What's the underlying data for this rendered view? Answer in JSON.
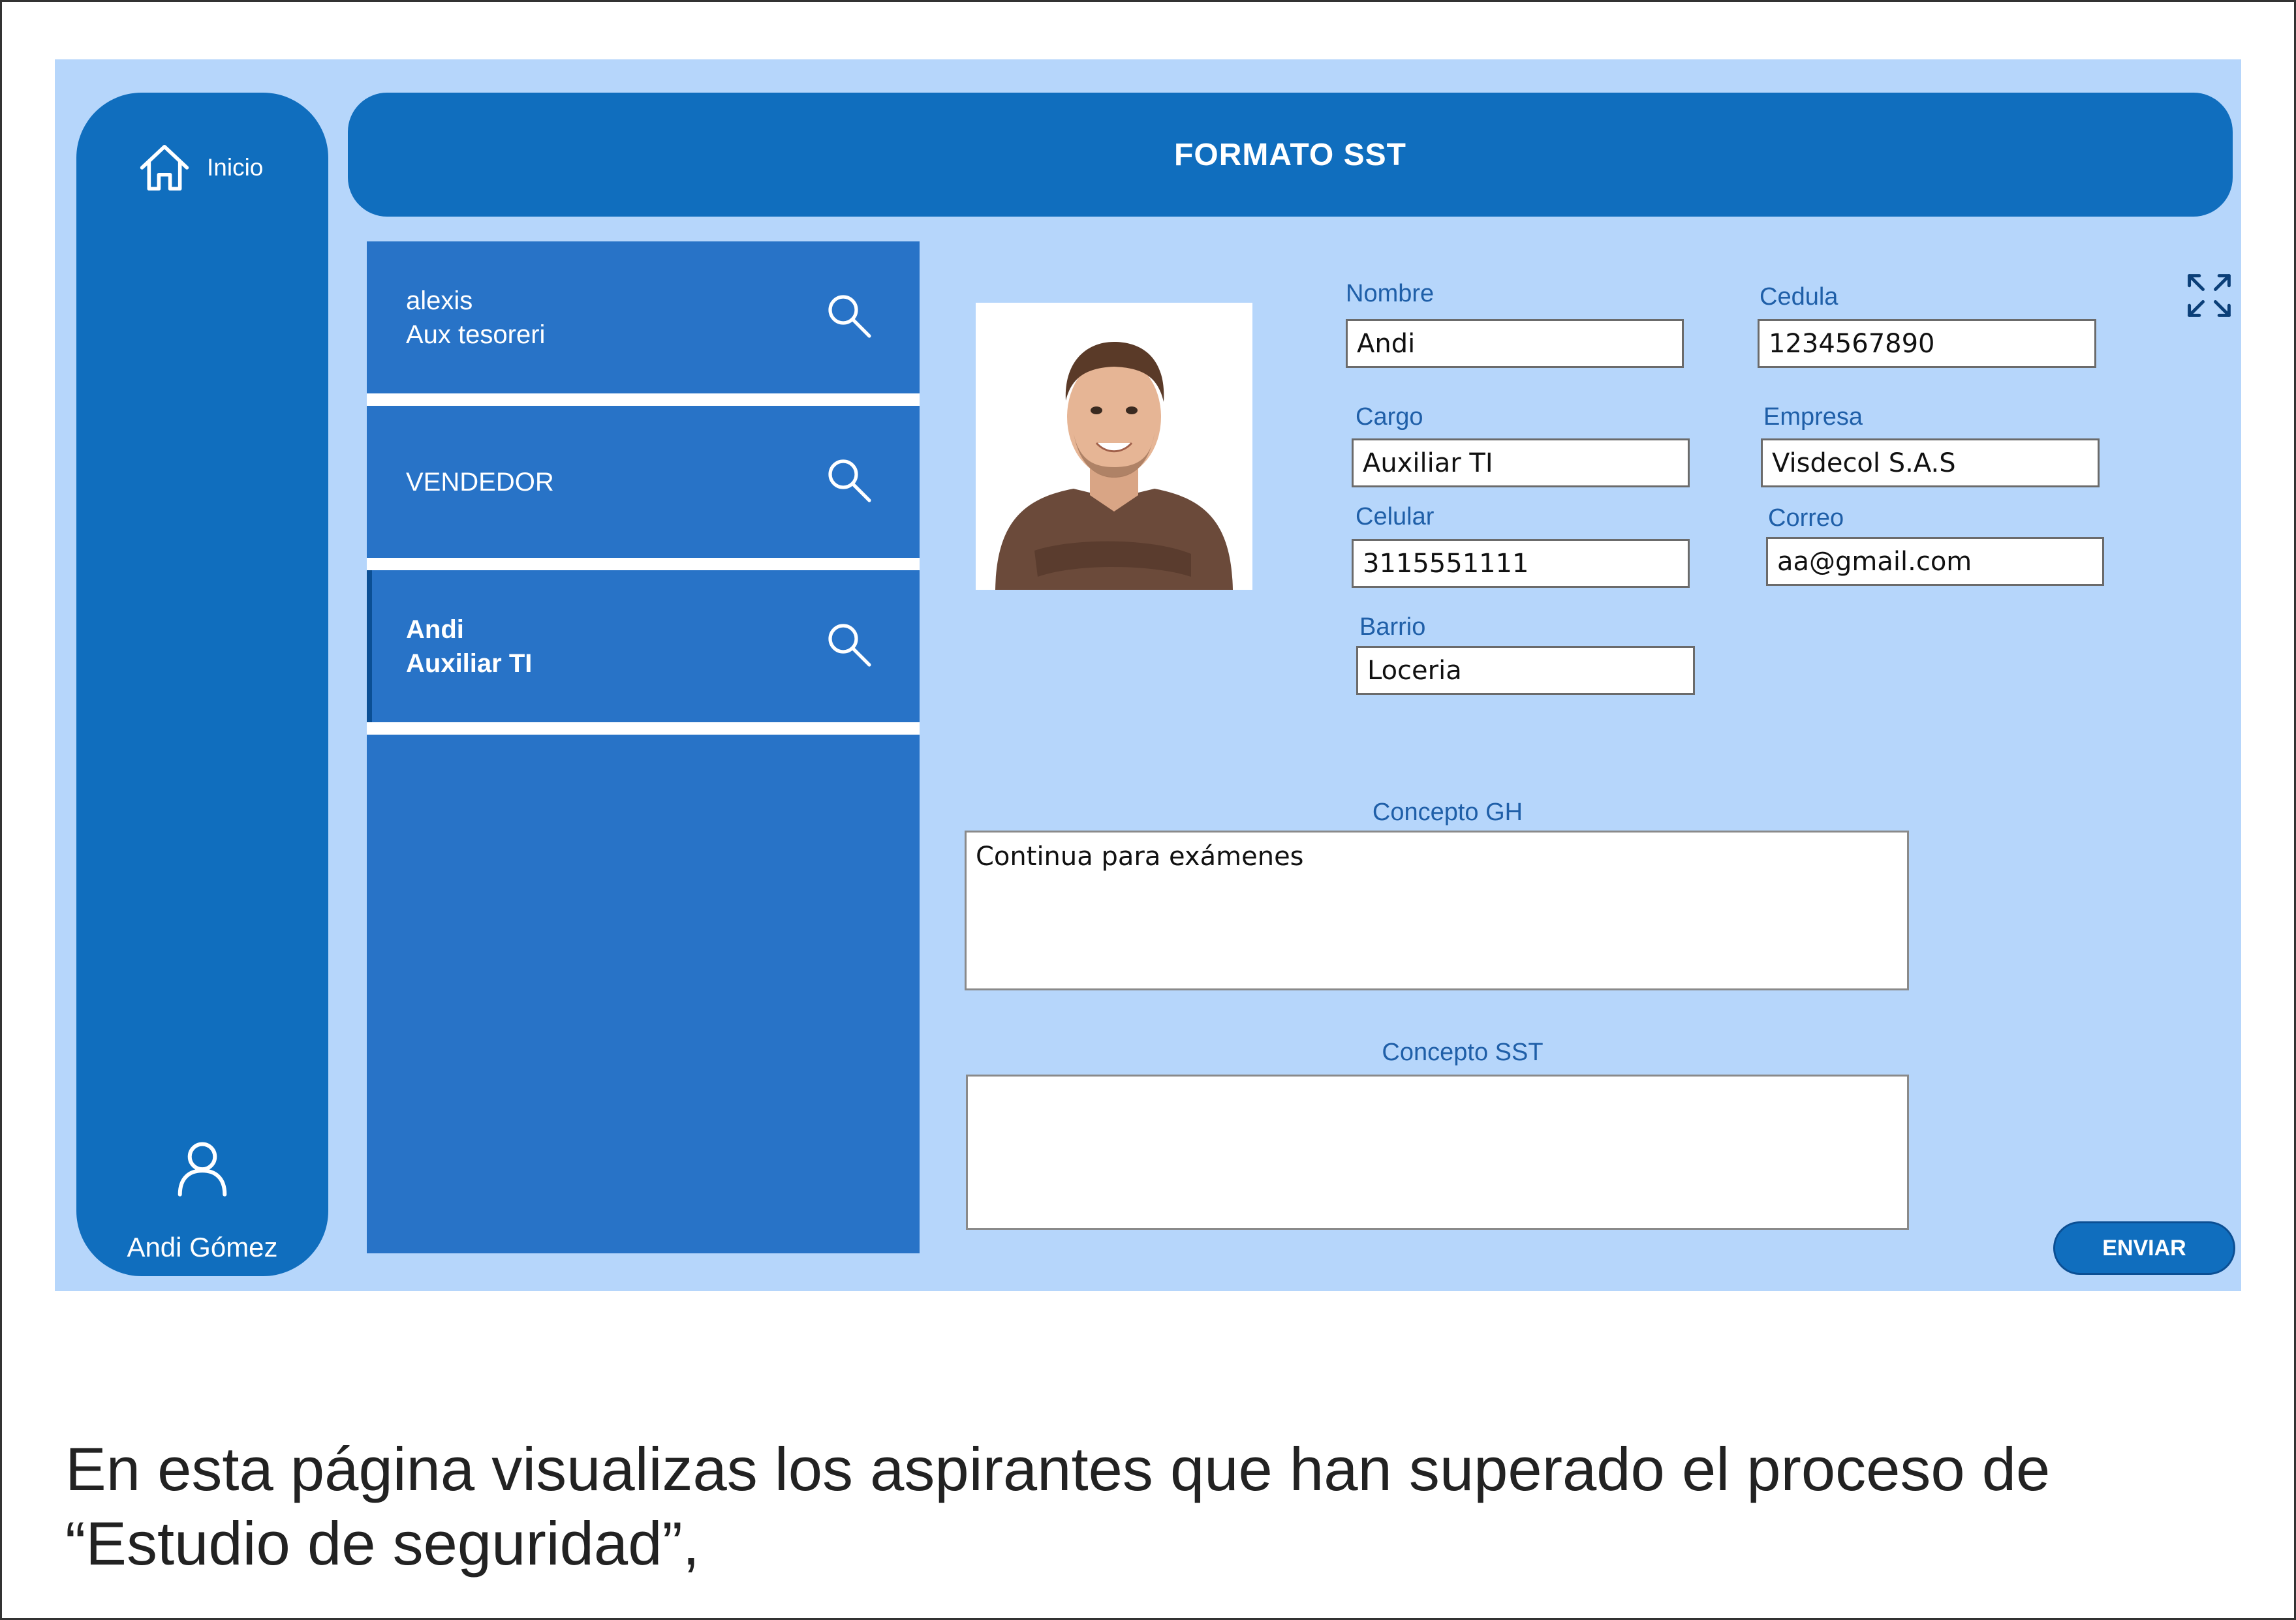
{
  "sidebar": {
    "home_label": "Inicio",
    "user_name": "Andi Gómez"
  },
  "header": {
    "title": "FORMATO SST"
  },
  "list": {
    "items": [
      {
        "line1": "alexis",
        "line2": "Aux tesoreri",
        "selected": false
      },
      {
        "line1": "VENDEDOR",
        "line2": "",
        "selected": false
      },
      {
        "line1": "Andi",
        "line2": "Auxiliar TI",
        "selected": true
      }
    ]
  },
  "form": {
    "nombre": {
      "label": "Nombre",
      "value": "Andi"
    },
    "cedula": {
      "label": "Cedula",
      "value": "1234567890"
    },
    "cargo": {
      "label": "Cargo",
      "value": "Auxiliar TI"
    },
    "empresa": {
      "label": "Empresa",
      "value": "Visdecol S.A.S"
    },
    "celular": {
      "label": "Celular",
      "value": "3115551111"
    },
    "correo": {
      "label": "Correo",
      "value": "aa@gmail.com"
    },
    "barrio": {
      "label": "Barrio",
      "value": "Loceria"
    },
    "concepto_gh": {
      "label": "Concepto GH",
      "value": "Continua para exámenes"
    },
    "concepto_sst": {
      "label": "Concepto SST",
      "value": ""
    },
    "send_label": "ENVIAR"
  },
  "caption": {
    "line1": "En esta página visualizas los aspirantes que han superado el proceso de",
    "line2": "“Estudio de seguridad”,"
  },
  "colors": {
    "app_background": "#b6d6fb",
    "primary": "#106ebe",
    "list_background": "#2873c7",
    "label": "#1f5fa8"
  }
}
